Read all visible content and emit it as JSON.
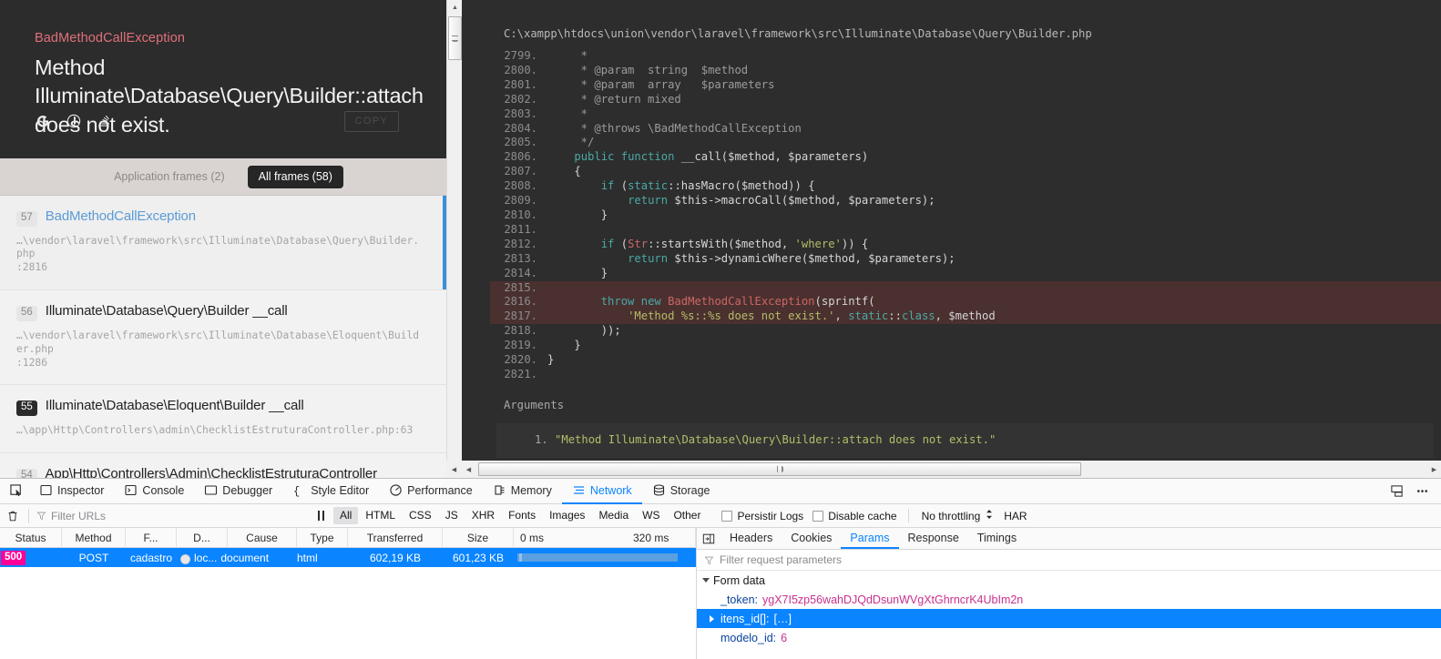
{
  "error": {
    "exception_class": "BadMethodCallException",
    "message": "Method Illuminate\\Database\\Query\\Builder::attach does not exist.",
    "copy_label": "COPY",
    "actions": [
      {
        "name": "google-search-icon",
        "label": "G"
      },
      {
        "name": "duckduckgo-search-icon",
        "label": "D"
      },
      {
        "name": "stackoverflow-search-icon",
        "label": "S"
      }
    ]
  },
  "frames_toggle": {
    "application_frames": "Application frames (2)",
    "all_frames": "All frames (58)",
    "active": "all_frames"
  },
  "frames": [
    {
      "num": "57",
      "name": "BadMethodCallException",
      "path": "…\\vendor\\laravel\\framework\\src\\Illuminate\\Database\\Query\\Builder.php",
      "line": ":2816",
      "selected": true,
      "is_link": true
    },
    {
      "num": "56",
      "name": "Illuminate\\Database\\Query\\Builder __call",
      "path": "…\\vendor\\laravel\\framework\\src\\Illuminate\\Database\\Eloquent\\Builder.php",
      "line": ":1286",
      "selected": false,
      "is_link": false
    },
    {
      "num": "55",
      "name": "Illuminate\\Database\\Eloquent\\Builder __call",
      "path": "…\\app\\Http\\Controllers\\admin\\ChecklistEstruturaController.php:63",
      "line": "",
      "selected": false,
      "is_link": false
    },
    {
      "num": "54",
      "name": "App\\Http\\Controllers\\Admin\\ChecklistEstruturaController cadastro",
      "path": "",
      "line": "",
      "selected": false,
      "is_link": false
    }
  ],
  "code": {
    "filepath": "C:\\xampp\\htdocs\\union\\vendor\\laravel\\framework\\src\\Illuminate\\Database\\Query\\Builder.php",
    "lines": [
      {
        "n": "2799.",
        "text": "     *",
        "hl": false
      },
      {
        "n": "2800.",
        "text": "     * @param  string  $method",
        "hl": false
      },
      {
        "n": "2801.",
        "text": "     * @param  array   $parameters",
        "hl": false
      },
      {
        "n": "2802.",
        "text": "     * @return mixed",
        "hl": false
      },
      {
        "n": "2803.",
        "text": "     *",
        "hl": false
      },
      {
        "n": "2804.",
        "text": "     * @throws \\BadMethodCallException",
        "hl": false
      },
      {
        "n": "2805.",
        "text": "     */",
        "hl": false
      },
      {
        "n": "2806.",
        "text": "    public function __call($method, $parameters)",
        "hl": false
      },
      {
        "n": "2807.",
        "text": "    {",
        "hl": false
      },
      {
        "n": "2808.",
        "text": "        if (static::hasMacro($method)) {",
        "hl": false
      },
      {
        "n": "2809.",
        "text": "            return $this->macroCall($method, $parameters);",
        "hl": false
      },
      {
        "n": "2810.",
        "text": "        }",
        "hl": false
      },
      {
        "n": "2811.",
        "text": "",
        "hl": false
      },
      {
        "n": "2812.",
        "text": "        if (Str::startsWith($method, 'where')) {",
        "hl": false
      },
      {
        "n": "2813.",
        "text": "            return $this->dynamicWhere($method, $parameters);",
        "hl": false
      },
      {
        "n": "2814.",
        "text": "        }",
        "hl": false
      },
      {
        "n": "2815.",
        "text": "",
        "hl": true
      },
      {
        "n": "2816.",
        "text": "        throw new BadMethodCallException(sprintf(",
        "hl": true
      },
      {
        "n": "2817.",
        "text": "            'Method %s::%s does not exist.', static::class, $method",
        "hl": true
      },
      {
        "n": "2818.",
        "text": "        ));",
        "hl": false
      },
      {
        "n": "2819.",
        "text": "    }",
        "hl": false
      },
      {
        "n": "2820.",
        "text": "}",
        "hl": false
      },
      {
        "n": "2821.",
        "text": "",
        "hl": false
      }
    ],
    "arguments_title": "Arguments",
    "arguments": [
      {
        "index": "1.",
        "value": "\"Method Illuminate\\Database\\Query\\Builder::attach does not exist.\""
      }
    ]
  },
  "devtools": {
    "tabs": [
      {
        "label": "Inspector",
        "icon": "inspector-icon",
        "active": false
      },
      {
        "label": "Console",
        "icon": "console-icon",
        "active": false
      },
      {
        "label": "Debugger",
        "icon": "debugger-icon",
        "active": false
      },
      {
        "label": "Style Editor",
        "icon": "style-editor-icon",
        "active": false
      },
      {
        "label": "Performance",
        "icon": "performance-icon",
        "active": false
      },
      {
        "label": "Memory",
        "icon": "memory-icon",
        "active": false
      },
      {
        "label": "Network",
        "icon": "network-icon",
        "active": true
      },
      {
        "label": "Storage",
        "icon": "storage-icon",
        "active": false
      }
    ],
    "filter_placeholder": "Filter URLs",
    "type_filters": [
      {
        "label": "All",
        "active": true
      },
      {
        "label": "HTML",
        "active": false
      },
      {
        "label": "CSS",
        "active": false
      },
      {
        "label": "JS",
        "active": false
      },
      {
        "label": "XHR",
        "active": false
      },
      {
        "label": "Fonts",
        "active": false
      },
      {
        "label": "Images",
        "active": false
      },
      {
        "label": "Media",
        "active": false
      },
      {
        "label": "WS",
        "active": false
      },
      {
        "label": "Other",
        "active": false
      }
    ],
    "persist_logs": "Persistir Logs",
    "disable_cache": "Disable cache",
    "throttling": "No throttling",
    "har": "HAR"
  },
  "network": {
    "columns": [
      "Status",
      "Method",
      "F...",
      "D...",
      "Cause",
      "Type",
      "Transferred",
      "Size"
    ],
    "timeline_ticks": [
      "0 ms",
      "320 ms"
    ],
    "rows": [
      {
        "status": "500",
        "method": "POST",
        "file": "cadastro",
        "domain": "loc...",
        "cause": "document",
        "type": "html",
        "transferred": "602,19 KB",
        "size": "601,23 KB",
        "selected": true
      }
    ]
  },
  "details": {
    "tabs": [
      {
        "label": "Headers",
        "active": false
      },
      {
        "label": "Cookies",
        "active": false
      },
      {
        "label": "Params",
        "active": true
      },
      {
        "label": "Response",
        "active": false
      },
      {
        "label": "Timings",
        "active": false
      }
    ],
    "filter_placeholder": "Filter request parameters",
    "group_label": "Form data",
    "params": [
      {
        "key": "_token:",
        "value": "ygX7I5zp56wahDJQdDsunWVgXtGhrncrK4UbIm2n",
        "expandable": false,
        "selected": false
      },
      {
        "key": "itens_id[]:",
        "value": "[…]",
        "expandable": true,
        "selected": true
      },
      {
        "key": "modelo_id:",
        "value": "6",
        "expandable": false,
        "selected": false
      }
    ]
  },
  "colors": {
    "accent": "#0a84ff",
    "error_class": "#e0707a",
    "status_500": "#ff0098",
    "code_bg": "#2d2d2d",
    "highlight": "#4a302f"
  }
}
